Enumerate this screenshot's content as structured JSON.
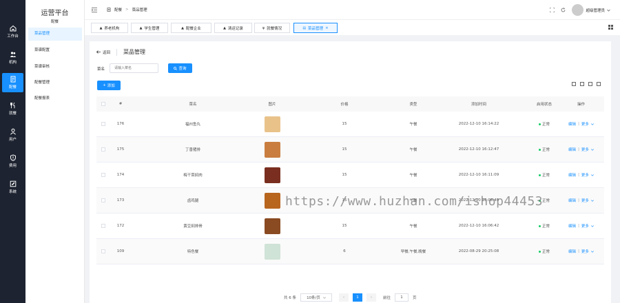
{
  "rail": [
    {
      "label": "工作台",
      "icon": "home-icon"
    },
    {
      "label": "机构",
      "icon": "users-icon"
    },
    {
      "label": "配餐",
      "icon": "document-icon",
      "active": true
    },
    {
      "label": "就餐",
      "icon": "utensils-icon"
    },
    {
      "label": "用户",
      "icon": "user-icon"
    },
    {
      "label": "费用",
      "icon": "shield-icon"
    },
    {
      "label": "系统",
      "icon": "edit-icon"
    }
  ],
  "submenu": {
    "title": "运营平台",
    "subtitle": "配餐",
    "items": [
      "菜品管理",
      "菜谱配置",
      "菜谱审核",
      "配餐管理",
      "配餐报表"
    ]
  },
  "topbar": {
    "breadcrumb": [
      "配餐",
      "菜品管理"
    ],
    "user": "超级管理员"
  },
  "tabs": [
    {
      "label": "养老机构",
      "icon": "building-icon"
    },
    {
      "label": "学生管理",
      "icon": "building-icon"
    },
    {
      "label": "配餐企业",
      "icon": "building-icon"
    },
    {
      "label": "清运记录",
      "icon": "building-icon"
    },
    {
      "label": "就餐情况",
      "icon": "utensils-icon"
    },
    {
      "label": "菜品管理",
      "icon": "document-icon",
      "active": true,
      "close": "×"
    }
  ],
  "page": {
    "back": "返回",
    "title": "菜品管理",
    "search_label": "菜名",
    "search_placeholder": "请输入菜名",
    "query": "查询",
    "add": "添加"
  },
  "table": {
    "columns": [
      "#",
      "菜名",
      "图片",
      "价格",
      "类型",
      "添加时间",
      "启用状态",
      "操作"
    ],
    "rows": [
      {
        "id": "176",
        "name": "福州鱼丸",
        "price": "15",
        "type": "午餐",
        "time": "2022-12-10 16:14:22",
        "status": "正常",
        "color": "#e9c28a"
      },
      {
        "id": "175",
        "name": "丁香猪排",
        "price": "15",
        "type": "午餐",
        "time": "2022-12-10 16:12:47",
        "status": "正常",
        "color": "#c97d3f"
      },
      {
        "id": "174",
        "name": "梅干菜焖肉",
        "price": "15",
        "type": "午餐",
        "time": "2022-12-10 16:11:09",
        "status": "正常",
        "color": "#7a2e1f"
      },
      {
        "id": "173",
        "name": "卤鸡腿",
        "price": "15",
        "type": "午餐",
        "time": "2022-12-10 16:08:49",
        "status": "正常",
        "color": "#b8651e"
      },
      {
        "id": "172",
        "name": "黄豆焖排骨",
        "price": "15",
        "type": "午餐",
        "time": "2022-12-10 16:06:42",
        "status": "正常",
        "color": "#8a4a22"
      },
      {
        "id": "109",
        "name": "特色餐",
        "price": "6",
        "type": "早餐,午餐,晚餐",
        "time": "2022-08-29 20:25:08",
        "status": "正常",
        "color": "#cfe3d6"
      }
    ],
    "edit": "编辑",
    "more": "更多",
    "sep": "|"
  },
  "pagination": {
    "total": "共 6 条",
    "size": "10条/页",
    "current": "1",
    "goto": "前往",
    "goto_value": "1",
    "page_unit": "页"
  },
  "watermark": "https://www.huzhan.com/ishop44453",
  "colors": {
    "primary": "#1890ff",
    "rail_bg": "#1d2330",
    "status_ok": "#13ce66"
  }
}
